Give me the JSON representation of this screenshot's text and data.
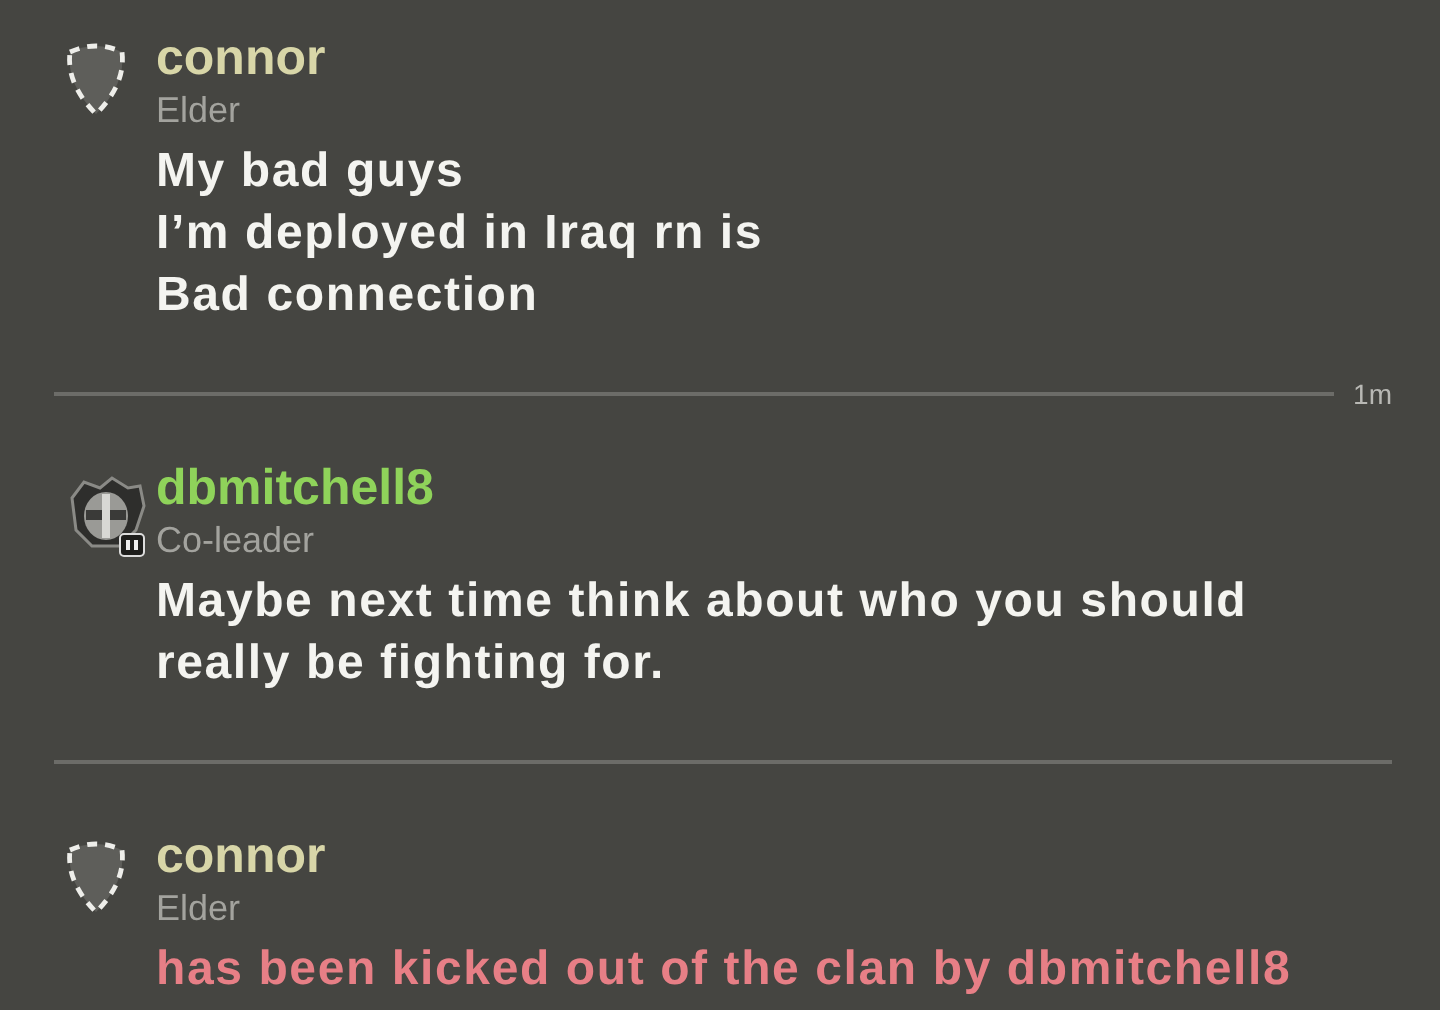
{
  "feed": [
    {
      "kind": "message",
      "emblem": false,
      "name": "connor",
      "color": "#d8d6a8",
      "role": "Elder",
      "lines": [
        "My bad guys",
        "I’m deployed in Iraq rn is",
        "Bad connection"
      ]
    },
    {
      "kind": "divider",
      "time": "1m"
    },
    {
      "kind": "message",
      "emblem": true,
      "name": "dbmitchell8",
      "color": "#8fd35a",
      "role": "Co-leader",
      "lines": [
        "Maybe next time think about who you should",
        "really be fighting for."
      ]
    },
    {
      "kind": "divider"
    },
    {
      "kind": "event",
      "emblem": false,
      "name": "connor",
      "color": "#d8d6a8",
      "role": "Elder",
      "lines": [
        "has been kicked out of the clan by dbmitchell8"
      ]
    }
  ]
}
